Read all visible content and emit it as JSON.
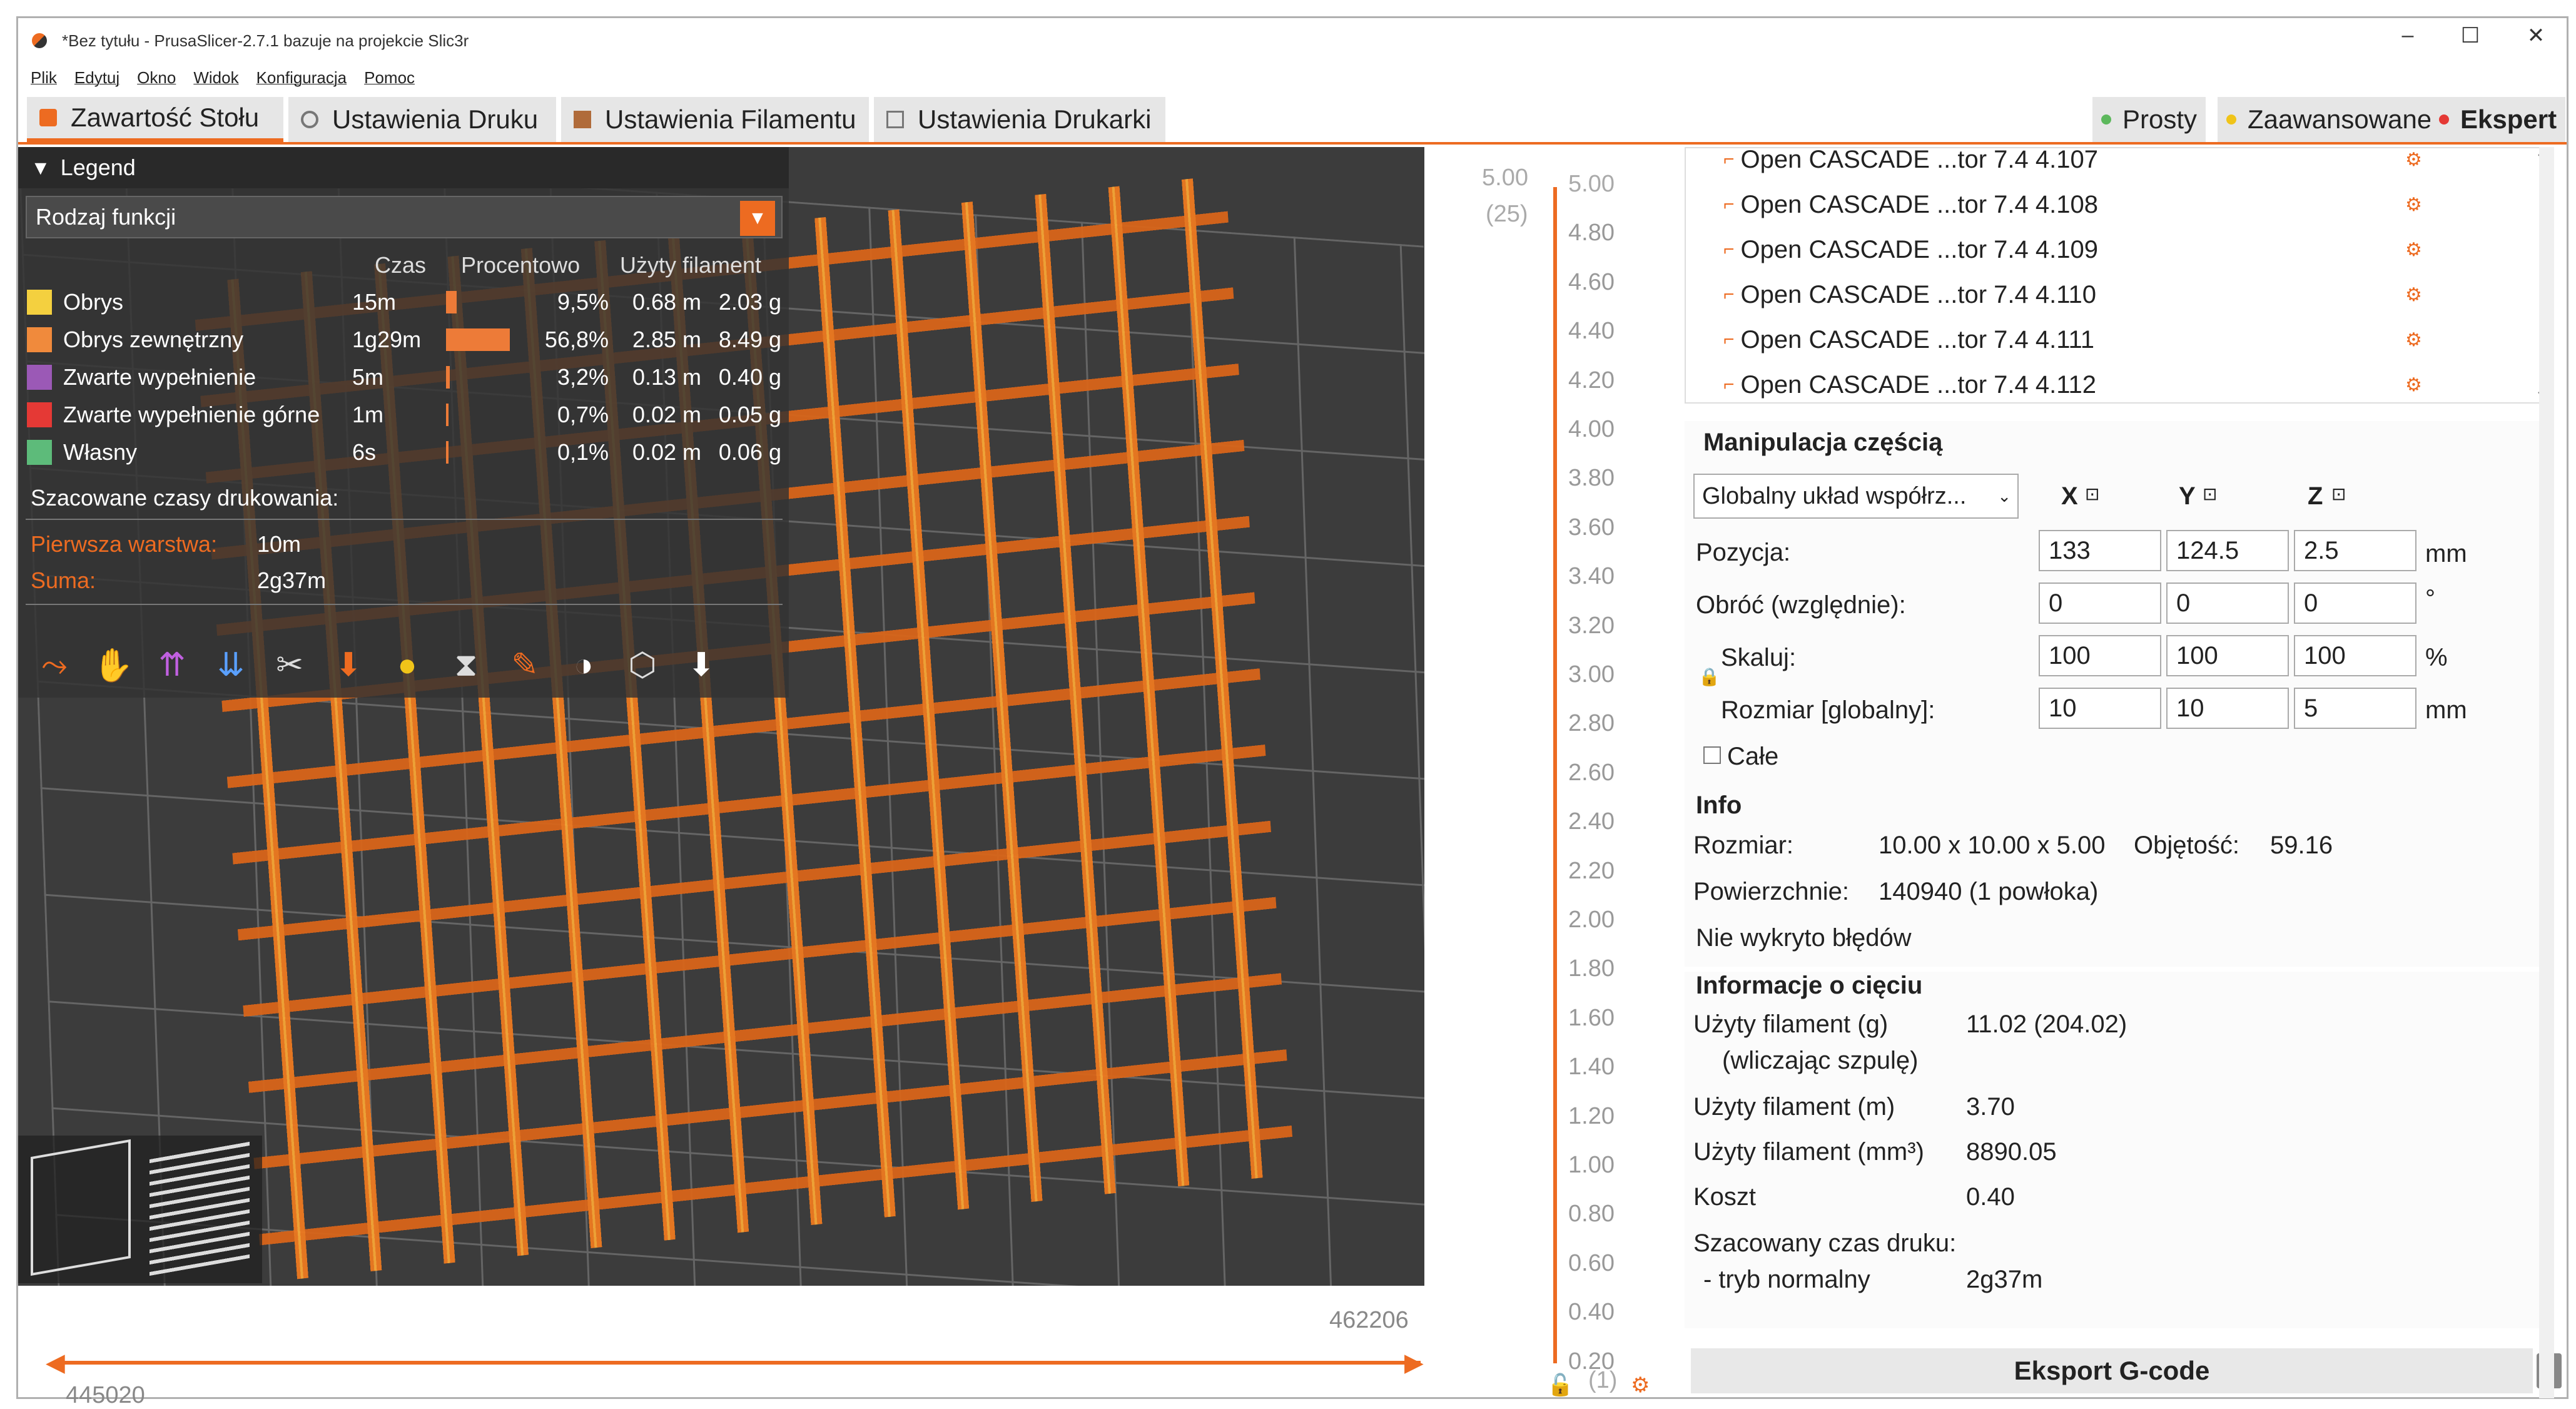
{
  "window": {
    "title": "*Bez tytułu - PrusaSlicer-2.7.1 bazuje na projekcie Slic3r",
    "minimize": "–",
    "maximize": "☐",
    "close": "✕"
  },
  "menu": [
    "Plik",
    "Edytuj",
    "Okno",
    "Widok",
    "Konfiguracja",
    "Pomoc"
  ],
  "tabs": [
    "Zawartość Stołu",
    "Ustawienia Druku",
    "Ustawienia Filamentu",
    "Ustawienia Drukarki"
  ],
  "modes": [
    {
      "label": "Prosty",
      "color": "#5cb85c"
    },
    {
      "label": "Zaawansowane",
      "color": "#f0c419"
    },
    {
      "label": "Ekspert",
      "color": "#e53935"
    }
  ],
  "legend": {
    "title": "Legend",
    "view_type": "Rodzaj funkcji",
    "columns": {
      "time": "Czas",
      "percent": "Procentowo",
      "filament": "Użyty filament"
    },
    "rows": [
      {
        "name": "Obrys",
        "color": "#f4d03f",
        "time": "15m",
        "percent": "9,5%",
        "pct": 9.5,
        "m": "0.68 m",
        "g": "2.03 g"
      },
      {
        "name": "Obrys zewnętrzny",
        "color": "#f08a3c",
        "time": "1g29m",
        "percent": "56,8%",
        "pct": 56.8,
        "m": "2.85 m",
        "g": "8.49 g"
      },
      {
        "name": "Zwarte wypełnienie",
        "color": "#9b59b6",
        "time": "5m",
        "percent": "3,2%",
        "pct": 3.2,
        "m": "0.13 m",
        "g": "0.40 g"
      },
      {
        "name": "Zwarte wypełnienie górne",
        "color": "#e53935",
        "time": "1m",
        "percent": "0,7%",
        "pct": 0.7,
        "m": "0.02 m",
        "g": "0.05 g"
      },
      {
        "name": "Własny",
        "color": "#5dbb7a",
        "time": "6s",
        "percent": "0,1%",
        "pct": 0.1,
        "m": "0.02 m",
        "g": "0.06 g"
      }
    ],
    "estimated": "Szacowane czasy drukowania:",
    "first_layer_label": "Pierwsza warstwa:",
    "first_layer": "10m",
    "total_label": "Suma:",
    "total": "2g37m"
  },
  "hslider": {
    "left": "445020",
    "right": "462206"
  },
  "vslider": {
    "top_left": "5.00",
    "top_sub": "(25)",
    "bottom_sub": "(1)",
    "ticks": [
      "5.00",
      "4.80",
      "4.60",
      "4.40",
      "4.20",
      "4.00",
      "3.80",
      "3.60",
      "3.40",
      "3.20",
      "3.00",
      "2.80",
      "2.60",
      "2.40",
      "2.20",
      "2.00",
      "1.80",
      "1.60",
      "1.40",
      "1.20",
      "1.00",
      "0.80",
      "0.60",
      "0.40",
      "0.20"
    ]
  },
  "objects": [
    "Open CASCADE ...tor 7.4 4.107",
    "Open CASCADE ...tor 7.4 4.108",
    "Open CASCADE ...tor 7.4 4.109",
    "Open CASCADE ...tor 7.4 4.110",
    "Open CASCADE ...tor 7.4 4.111",
    "Open CASCADE ...tor 7.4 4.112"
  ],
  "manip": {
    "title": "Manipulacja częścią",
    "coord": "Globalny układ współrz...",
    "axes": [
      "X",
      "Y",
      "Z"
    ],
    "pos_label": "Pozycja:",
    "pos": [
      "133",
      "124.5",
      "2.5"
    ],
    "pos_unit": "mm",
    "rot_label": "Obróć (względnie):",
    "rot": [
      "0",
      "0",
      "0"
    ],
    "rot_unit": "°",
    "scale_label": "Skaluj:",
    "scale": [
      "100",
      "100",
      "100"
    ],
    "scale_unit": "%",
    "size_label": "Rozmiar [globalny]:",
    "size": [
      "10",
      "10",
      "5"
    ],
    "size_unit": "mm",
    "whole": "Całe"
  },
  "info": {
    "title": "Info",
    "size_label": "Rozmiar:",
    "size": "10.00 x 10.00 x 5.00",
    "volume_label": "Objętość:",
    "volume": "59.16",
    "facets_label": "Powierzchnie:",
    "facets": "140940 (1 powłoka)",
    "errors": "Nie wykryto błędów"
  },
  "slice": {
    "title": "Informacje o cięciu",
    "rows": [
      {
        "label": "Użyty filament (g)",
        "value": "11.02 (204.02)"
      },
      {
        "label": "(wliczając szpulę)",
        "value": ""
      },
      {
        "label": "Użyty filament (m)",
        "value": "3.70"
      },
      {
        "label": "Użyty filament (mm³)",
        "value": "8890.05"
      },
      {
        "label": "Koszt",
        "value": "0.40"
      },
      {
        "label": "Szacowany czas druku:",
        "value": ""
      },
      {
        "label": "- tryb normalny",
        "value": "2g37m"
      }
    ]
  },
  "export": "Eksport G-code"
}
